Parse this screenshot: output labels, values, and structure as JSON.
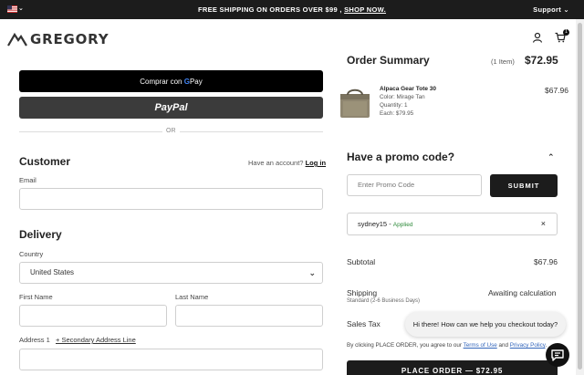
{
  "topbar": {
    "locale_icon": "us-flag-icon",
    "promo_text": "FREE SHIPPING ON ORDERS OVER $99 ,",
    "promo_link": "SHOP NOW.",
    "support_label": "Support"
  },
  "header": {
    "logo_text": "GREGORY",
    "cart_count": "1"
  },
  "payments": {
    "gpay_label": "Comprar con",
    "gpay_brand": "Pay",
    "paypal_label": "PayPal",
    "or_label": "OR"
  },
  "customer": {
    "title": "Customer",
    "account_prompt": "Have an account?",
    "login_link": "Log in",
    "email_label": "Email",
    "email_value": ""
  },
  "delivery": {
    "title": "Delivery",
    "country_label": "Country",
    "country_value": "United States",
    "first_name_label": "First Name",
    "last_name_label": "Last Name",
    "address1_label": "Address 1",
    "secondary_link": "+ Secondary Address Line"
  },
  "summary": {
    "title": "Order Summary",
    "item_count": "(1 Item)",
    "total": "$72.95",
    "item": {
      "name": "Alpaca Gear Tote 30",
      "color": "Color: Mirage Tan",
      "quantity": "Quantity: 1",
      "each": "Each: $79.95",
      "price": "$67.96"
    }
  },
  "promo": {
    "title": "Have a promo code?",
    "placeholder": "Enter Promo Code",
    "submit_label": "SUBMIT",
    "applied_code": "sydney15 -",
    "applied_status": "Applied"
  },
  "totals": {
    "subtotal_label": "Subtotal",
    "subtotal_value": "$67.96",
    "shipping_label": "Shipping",
    "shipping_sub": "Standard (2-6 Business Days)",
    "shipping_value": "Awaiting calculation",
    "tax_label": "Sales Tax"
  },
  "checkout": {
    "terms_prefix": "By clicking PLACE ORDER, you agree to our",
    "terms_link": "Terms of Use",
    "terms_and": "and",
    "privacy_link": "Privacy Policy",
    "place_order_label": "PLACE ORDER — $72.95"
  },
  "chat": {
    "bubble_text": "Hi there! How can we help you checkout today?"
  }
}
